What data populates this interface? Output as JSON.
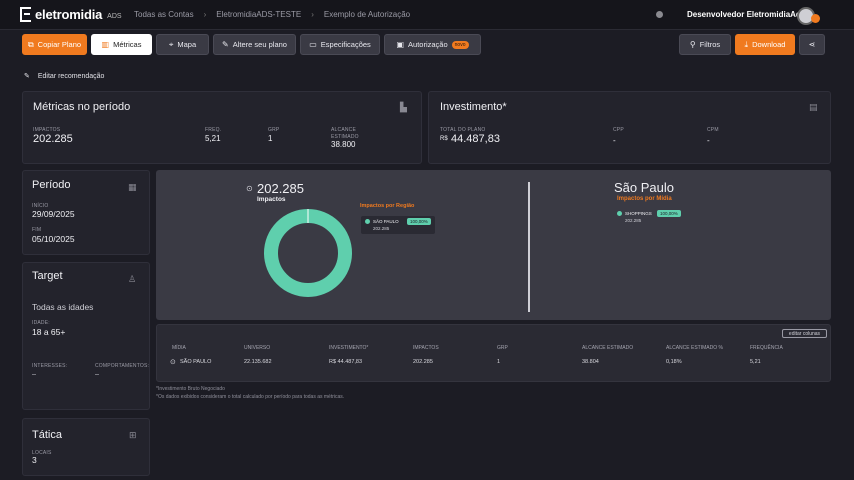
{
  "header": {
    "logo_text": "eletromidia",
    "logo_sub": "ADS",
    "breadcrumbs": [
      "Todas as Contas",
      "EletromidiaADS-TESTE",
      "Exemplo de Autorização"
    ],
    "user_name": "Desenvolvedor EletromidiaAds"
  },
  "toolbar": {
    "copy_plan": "Copiar Plano",
    "metrics": "Métricas",
    "map": "Mapa",
    "edit_plan": "Altere seu plano",
    "specs": "Especificações",
    "authorization": "Autorização",
    "authorization_badge": "novo",
    "filters": "Filtros",
    "download": "Download"
  },
  "edit_recommendation": "Editar recomendação",
  "metrics_card": {
    "title": "Métricas no período",
    "impacts_label": "IMPACTOS",
    "impacts_value": "202.285",
    "freq_label": "FREQ.",
    "freq_value": "5,21",
    "grp_label": "GRP",
    "grp_value": "1",
    "reach_label_1": "ALCANCE",
    "reach_label_2": "ESTIMADO",
    "reach_value": "38.800"
  },
  "investment_card": {
    "title": "Investimento*",
    "total_label": "TOTAL DO PLANO",
    "currency": "R$",
    "total_value": "44.487,83",
    "cpp_label": "CPP",
    "cpp_value": "-",
    "cpm_label": "CPM",
    "cpm_value": "-"
  },
  "period_card": {
    "title": "Período",
    "start_label": "INÍCIO",
    "start_value": "29/09/2025",
    "end_label": "FIM",
    "end_value": "05/10/2025"
  },
  "target_card": {
    "title": "Target",
    "audience": "Todas as idades",
    "age_label": "IDADE:",
    "age_value": "18 a 65+",
    "interests_label": "INTERESSES:",
    "interests_value": "--",
    "behaviors_label": "COMPORTAMENTOS:",
    "behaviors_value": "--"
  },
  "tactic_card": {
    "title": "Tática",
    "locals_label": "LOCAIS",
    "locals_value": "3"
  },
  "chart_panel": {
    "total_value": "202.285",
    "total_label": "Impactos",
    "region_title": "Impactos por Região",
    "region_item": "SÃO PAULO",
    "region_pct": "100,00%",
    "region_value": "202.285",
    "city": "São Paulo",
    "media_title": "Impactos por Mídia",
    "media_item": "SHOPPINGS",
    "media_pct": "100,00%",
    "media_value": "202.285"
  },
  "chart_data": {
    "type": "pie",
    "categories": [
      "SÃO PAULO"
    ],
    "values": [
      202285
    ],
    "colors": [
      "#5fcfad"
    ]
  },
  "table": {
    "edit_columns": "editar colunas",
    "headers": [
      "MÍDIA",
      "UNIVERSO",
      "INVESTIMENTO*",
      "IMPACTOS",
      "GRP",
      "ALCANCE ESTIMADO",
      "ALCANCE ESTIMADO %",
      "FREQUÊNCIA"
    ],
    "row": [
      "SÃO PAULO",
      "22.135.682",
      "R$ 44.487,83",
      "202.285",
      "1",
      "38.804",
      "0,18%",
      "5,21"
    ]
  },
  "footnotes": [
    "*Investimento Bruto Negociado",
    "*Os dados exibidos consideram o total calculado por período para todas as métricas."
  ],
  "colors": {
    "accent": "#f07a1f",
    "teal": "#5fcfad",
    "background": "#1c1c24",
    "card": "#23232c"
  }
}
